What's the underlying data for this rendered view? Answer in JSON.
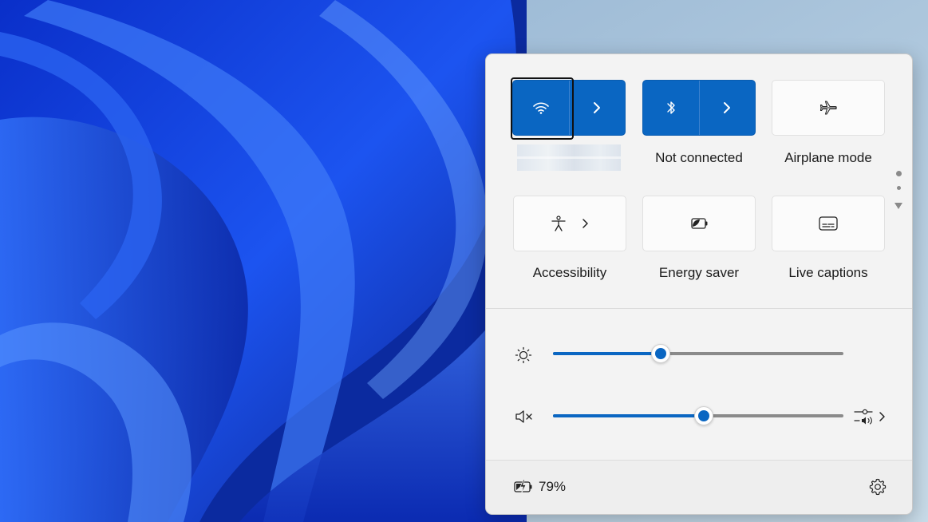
{
  "desktop": {
    "wallpaper": "windows-11-bloom-icon"
  },
  "quick_settings": {
    "tiles_row1": [
      {
        "id": "wifi",
        "label": "",
        "state": "on",
        "icon": "wifi-icon",
        "expand_icon": "chevron-right-icon"
      },
      {
        "id": "bluetooth",
        "label": "Not connected",
        "state": "on",
        "icon": "bluetooth-icon",
        "expand_icon": "chevron-right-icon"
      },
      {
        "id": "airplane",
        "label": "Airplane mode",
        "state": "off",
        "icon": "airplane-icon"
      }
    ],
    "tiles_row2": [
      {
        "id": "accessibility",
        "label": "Accessibility",
        "state": "off",
        "icon": "accessibility-icon",
        "expand_icon": "chevron-right-icon"
      },
      {
        "id": "energy_saver",
        "label": "Energy saver",
        "state": "off",
        "icon": "energy-saver-icon"
      },
      {
        "id": "live_captions",
        "label": "Live captions",
        "state": "off",
        "icon": "captions-icon"
      }
    ],
    "pager": {
      "pages": 2,
      "current": 1
    },
    "brightness": {
      "icon": "brightness-icon",
      "value": 37
    },
    "volume": {
      "icon": "volume-muted-icon",
      "value": 52,
      "mixer_icon": "audio-mixer-icon",
      "expand_icon": "chevron-right-icon"
    },
    "footer": {
      "battery_icon": "battery-charging-icon",
      "battery_text": "79%",
      "settings_icon": "gear-icon"
    }
  },
  "colors": {
    "accent": "#0a66c2",
    "panel_bg": "#f3f3f3",
    "footer_bg": "#eeeeee"
  }
}
